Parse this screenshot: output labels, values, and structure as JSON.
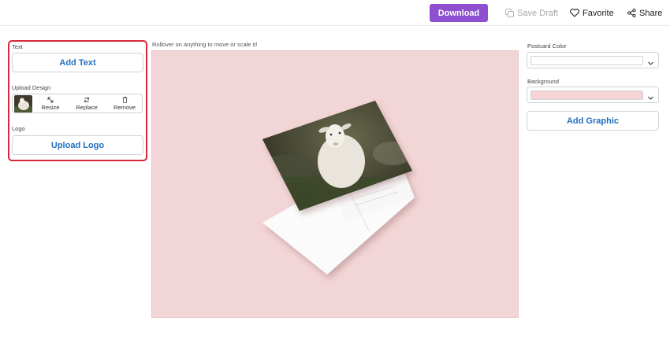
{
  "topbar": {
    "download_label": "Download",
    "save_draft_label": "Save Draft",
    "favorite_label": "Favorite",
    "share_label": "Share"
  },
  "left_panel": {
    "text_section_label": "Text",
    "add_text_label": "Add Text",
    "upload_section_label": "Upload Design",
    "resize_label": "Resize",
    "replace_label": "Replace",
    "remove_label": "Remove",
    "logo_section_label": "Logo",
    "upload_logo_label": "Upload Logo"
  },
  "canvas": {
    "hint": "Rollover on anything to move or scale it!"
  },
  "right_panel": {
    "postcard_color_label": "Postcard Color",
    "postcard_color_value": "#ffffff",
    "background_label": "Background",
    "background_value": "#f6d3d4",
    "add_graphic_label": "Add Graphic"
  },
  "colors": {
    "accent": "#8e4fd0",
    "link_blue": "#1f6fbf",
    "highlight_border": "#d8283a",
    "canvas_bg": "#f2d5d6"
  }
}
